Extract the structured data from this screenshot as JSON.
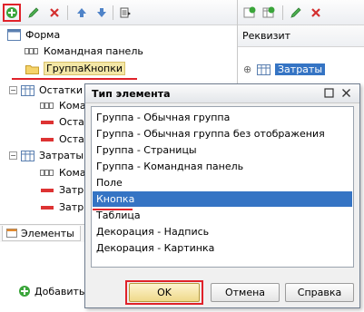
{
  "left_tree": [
    {
      "label": "Форма"
    },
    {
      "label": "Командная панель"
    },
    {
      "label": "ГруппаКнопки"
    },
    {
      "label": "Остатки"
    },
    {
      "label": "Коман"
    },
    {
      "label": "Оста"
    },
    {
      "label": "Оста"
    },
    {
      "label": "Затраты"
    },
    {
      "label": "Коман"
    },
    {
      "label": "Затр"
    },
    {
      "label": "Затр"
    }
  ],
  "tabs": {
    "elements": "Элементы"
  },
  "bottom": {
    "add_label": "Добавить"
  },
  "right_pane": {
    "header": "Реквизит",
    "rows": [
      {
        "label": "Затраты"
      }
    ]
  },
  "dialog": {
    "title": "Тип элемента",
    "items": [
      "Группа - Обычная группа",
      "Группа - Обычная группа без отображения",
      "Группа - Страницы",
      "Группа - Командная панель",
      "Поле",
      "Кнопка",
      "Таблица",
      "Декорация - Надпись",
      "Декорация - Картинка"
    ],
    "selected_index": 5,
    "ok_label": "OK",
    "cancel_label": "Отмена",
    "help_label": "Справка"
  },
  "colors": {
    "selection": "#3574c4",
    "highlight_red": "#e0222a",
    "group_label_bg": "#f3e7a6"
  }
}
